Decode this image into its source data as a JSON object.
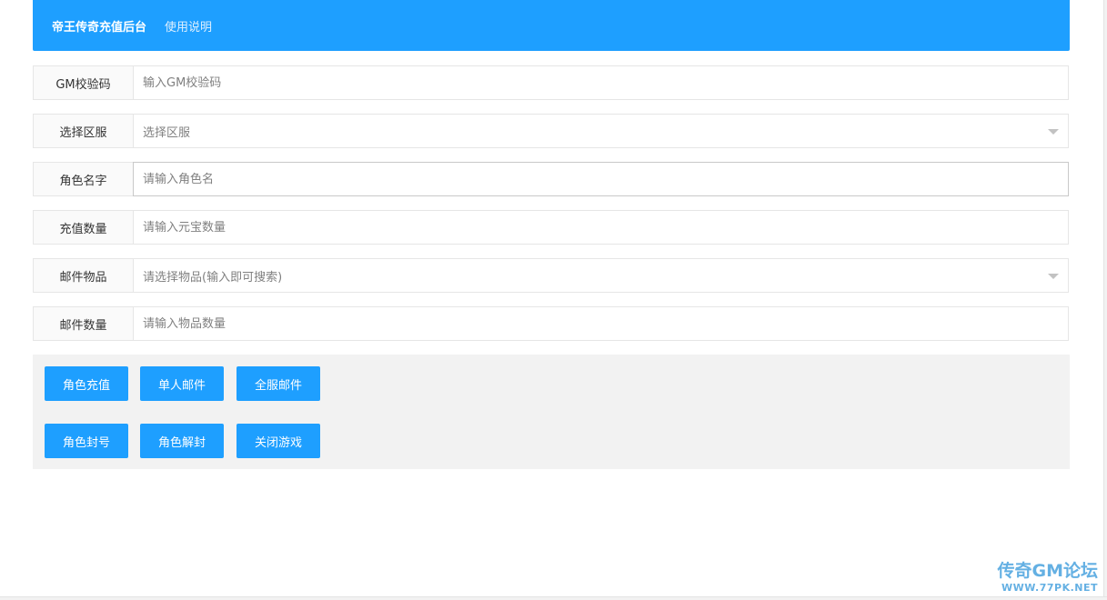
{
  "header": {
    "brand": "帝王传奇充值后台",
    "nav_link": "使用说明",
    "color": "#1e9fff"
  },
  "form": {
    "gm_code": {
      "label": "GM校验码",
      "placeholder": "输入GM校验码",
      "value": ""
    },
    "server": {
      "label": "选择区服",
      "selected": "选择区服"
    },
    "role_name": {
      "label": "角色名字",
      "placeholder": "请输入角色名",
      "value": ""
    },
    "recharge_amount": {
      "label": "充值数量",
      "placeholder": "请输入元宝数量",
      "value": ""
    },
    "mail_item": {
      "label": "邮件物品",
      "selected": "请选择物品(输入即可搜索)"
    },
    "mail_quantity": {
      "label": "邮件数量",
      "placeholder": "请输入物品数量",
      "value": ""
    }
  },
  "buttons": {
    "role_recharge": "角色充值",
    "single_mail": "单人邮件",
    "all_server_mail": "全服邮件",
    "ban_role": "角色封号",
    "unban_role": "角色解封",
    "close_game": "关闭游戏"
  },
  "watermark": {
    "main": "传奇GM论坛",
    "sub": "WWW.77PK.NET"
  }
}
